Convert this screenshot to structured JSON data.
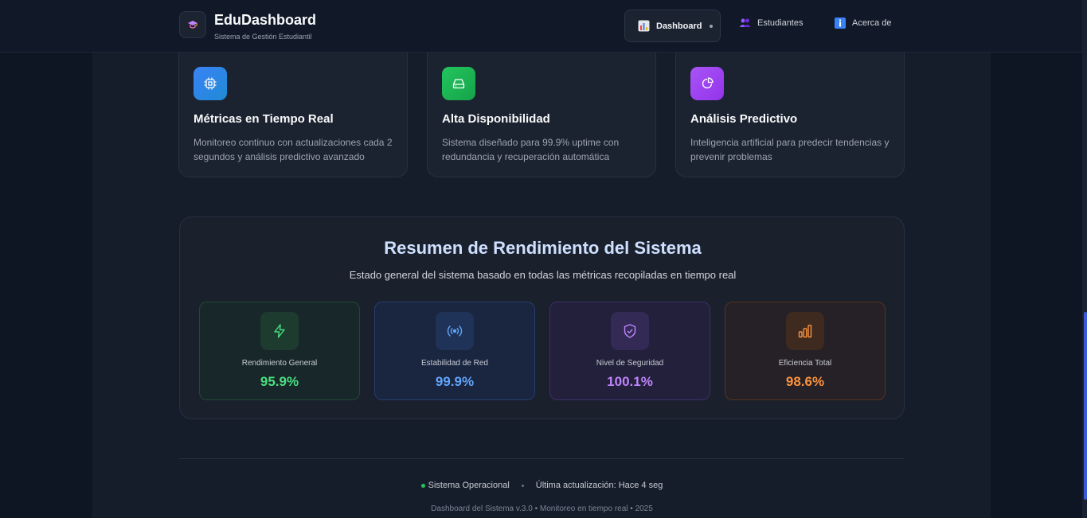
{
  "header": {
    "app_name": "EduDashboard",
    "app_subtitle": "Sistema de Gestión Estudiantil",
    "logo_icon": "graduation-cap-icon",
    "nav": [
      {
        "label": "Dashboard",
        "icon": "bar-chart-icon",
        "active": true
      },
      {
        "label": "Estudiantes",
        "icon": "users-icon",
        "active": false
      },
      {
        "label": "Acerca de",
        "icon": "info-icon",
        "active": false
      }
    ]
  },
  "features": [
    {
      "title": "Métricas en Tiempo Real",
      "description": "Monitoreo continuo con actualizaciones cada 2 segundos y análisis predictivo avanzado",
      "icon": "cpu-icon",
      "color": "#3b82f6"
    },
    {
      "title": "Alta Disponibilidad",
      "description": "Sistema diseñado para 99.9% uptime con redundancia y recuperación automática",
      "icon": "hard-drive-icon",
      "color": "#22c55e"
    },
    {
      "title": "Análisis Predictivo",
      "description": "Inteligencia artificial para predecir tendencias y prevenir problemas",
      "icon": "pie-chart-icon",
      "color": "#a855f7"
    }
  ],
  "summary": {
    "title": "Resumen de Rendimiento del Sistema",
    "subtitle": "Estado general del sistema basado en todas las métricas recopiladas en tiempo real",
    "metrics": [
      {
        "label": "Rendimiento General",
        "value": "95.9%",
        "icon": "lightning-icon",
        "color": "#4ade80"
      },
      {
        "label": "Estabilidad de Red",
        "value": "99.9%",
        "icon": "broadcast-icon",
        "color": "#60a5fa"
      },
      {
        "label": "Nivel de Seguridad",
        "value": "100.1%",
        "icon": "shield-check-icon",
        "color": "#c084fc"
      },
      {
        "label": "Eficiencia Total",
        "value": "98.6%",
        "icon": "bar-chart-icon",
        "color": "#fb923c"
      }
    ]
  },
  "footer": {
    "status": "Sistema Operacional",
    "last_update": "Última actualización: Hace 4 seg",
    "copyright": "Dashboard del Sistema v.3.0 • Monitoreo en tiempo real • 2025"
  }
}
